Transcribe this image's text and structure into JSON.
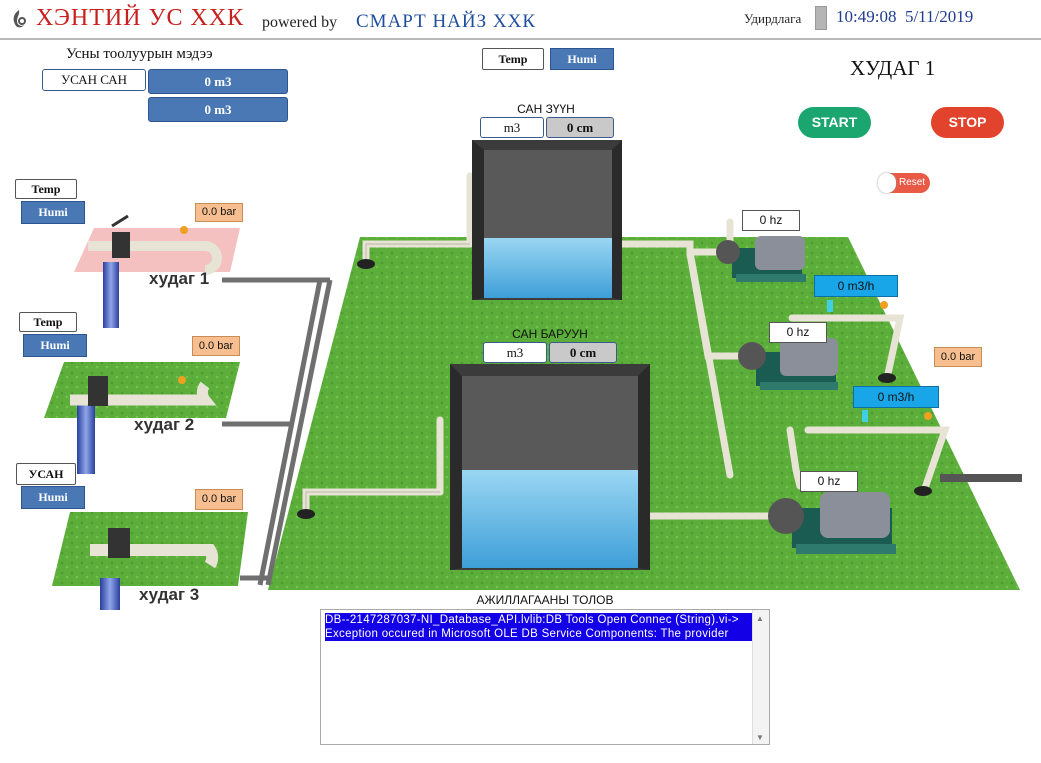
{
  "header": {
    "company": "ХЭНТИЙ УС ХХК",
    "powered_by": "powered by",
    "partner": "СМАРТ НАЙЗ ХХК",
    "control_label": "Удирдлага",
    "time": "10:49:08",
    "date": "5/11/2019"
  },
  "meter": {
    "title": "Усны тоолуурын мэдээ",
    "source_label": "УСАН САН",
    "value1": "0 m3",
    "value2": "0 m3"
  },
  "top_toggles": {
    "temp": "Temp",
    "humi": "Humi"
  },
  "station_title": "ХУДАГ 1",
  "controls": {
    "start": "START",
    "stop": "STOP",
    "reset": "Reset"
  },
  "tanks": [
    {
      "name": "САН ЗҮҮН",
      "volume": "m3",
      "level": "0 cm"
    },
    {
      "name": "САН БАРУУН",
      "volume": "m3",
      "level": "0 cm"
    }
  ],
  "wells": [
    {
      "name": "худаг 1",
      "temp_label": "Temp",
      "humi_label": "Humi",
      "pressure": "0.0 bar"
    },
    {
      "name": "худаг 2",
      "temp_label": "Temp",
      "humi_label": "Humi",
      "pressure": "0.0 bar"
    },
    {
      "name": "худаг 3",
      "temp_label": "УСАН",
      "humi_label": "Humi",
      "pressure": "0.0 bar"
    }
  ],
  "pumps": [
    {
      "freq": "0 hz"
    },
    {
      "freq": "0 hz"
    },
    {
      "freq": "0 hz"
    }
  ],
  "flows": [
    {
      "value": "0 m3/h"
    },
    {
      "value": "0 m3/h"
    }
  ],
  "outlet_pressure": "0.0 bar",
  "log": {
    "title": "АЖИЛЛАГААНЫ ТОЛОВ",
    "lines": [
      "DB--2147287037-NI_Database_API.lvlib:DB Tools Open Connec (String).vi->",
      "Exception occured in Microsoft OLE DB Service Components: The provider"
    ]
  },
  "colors": {
    "brand_red": "#c8201e",
    "brand_blue": "#1f4e9c",
    "grass": "#5cae3a",
    "water": "#5fb6e6",
    "start": "#1aa66e",
    "stop": "#e2432c"
  }
}
